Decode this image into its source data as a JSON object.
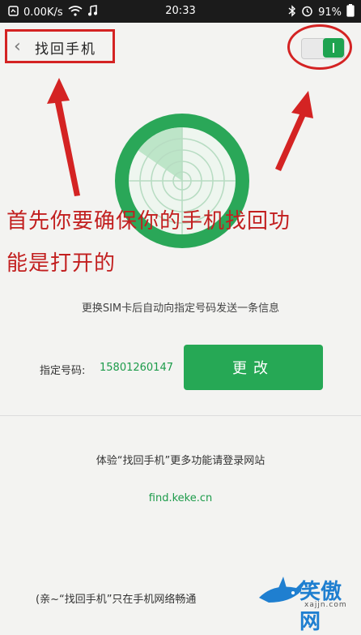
{
  "status_bar": {
    "speed": "0.00K/s",
    "time": "20:33",
    "battery": "91%"
  },
  "header": {
    "title": "找回手机",
    "back_icon": "chevron-left-icon",
    "toggle_state": "on"
  },
  "annotation": {
    "line1": "首先你要确保你的手机找回功",
    "line2": "能是打开的"
  },
  "main": {
    "info": "更换SIM卡后自动向指定号码发送一条信息",
    "number_label": "指定号码:",
    "number_value": "15801260147",
    "change_button": "更改",
    "more_info": "体验“找回手机”更多功能请登录网站",
    "website": "find.keke.cn",
    "note": "(亲~“找回手机”只在手机网络畅通"
  },
  "watermark": {
    "text": "笑傲网",
    "sub": "xajjn.com"
  },
  "colors": {
    "accent_green": "#26a855",
    "annotation_red": "#c21f1f",
    "status_bar": "#1b1b1b"
  }
}
